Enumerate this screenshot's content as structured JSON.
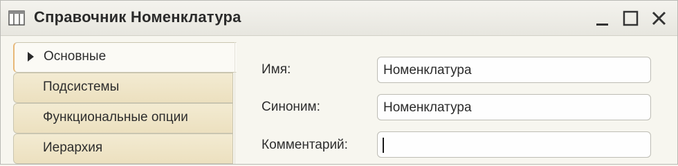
{
  "window": {
    "title": "Справочник Номенклатура"
  },
  "tabs": [
    {
      "label": "Основные",
      "active": true
    },
    {
      "label": "Подсистемы",
      "active": false
    },
    {
      "label": "Функциональные опции",
      "active": false
    },
    {
      "label": "Иерархия",
      "active": false
    }
  ],
  "form": {
    "name": {
      "label": "Имя:",
      "value": "Номенклатура"
    },
    "synonym": {
      "label": "Синоним:",
      "value": "Номенклатура"
    },
    "comment": {
      "label": "Комментарий:",
      "value": ""
    }
  },
  "icons": {
    "window_icon": "table-icon",
    "minimize": "minimize-icon",
    "maximize": "maximize-icon",
    "close": "close-icon"
  }
}
